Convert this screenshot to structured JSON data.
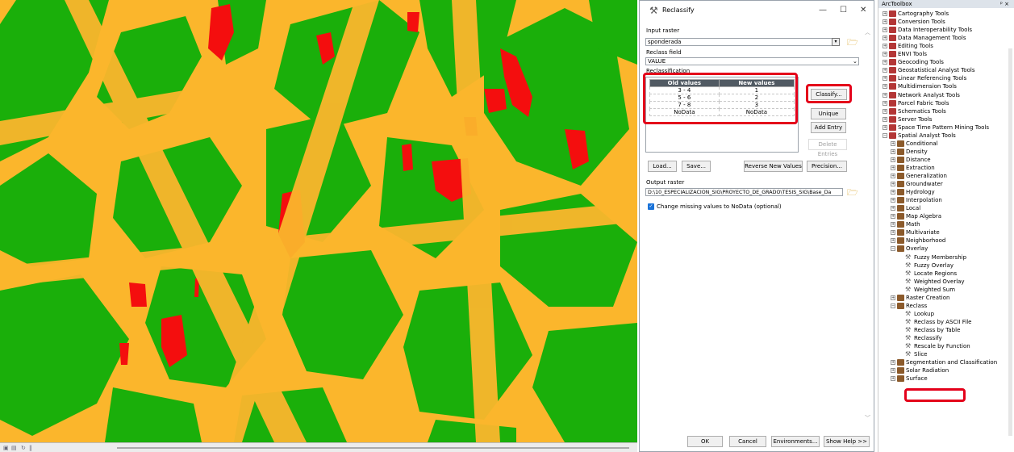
{
  "dialog": {
    "title": "Reclassify",
    "input_raster_label": "Input raster",
    "input_raster_value": "sponderada",
    "reclass_field_label": "Reclass field",
    "reclass_field_value": "VALUE",
    "reclassification_label": "Reclassification",
    "table": {
      "headers": [
        "Old values",
        "New values"
      ],
      "rows": [
        [
          "3 - 4",
          "1"
        ],
        [
          "5 - 6",
          "2"
        ],
        [
          "7 - 8",
          "3"
        ],
        [
          "NoData",
          "NoData"
        ]
      ]
    },
    "buttons": {
      "classify": "Classify...",
      "unique": "Unique",
      "add_entry": "Add Entry",
      "delete_entries": "Delete Entries",
      "load": "Load...",
      "save": "Save...",
      "reverse": "Reverse New Values",
      "precision": "Precision...",
      "ok": "OK",
      "cancel": "Cancel",
      "environments": "Environments...",
      "show_help": "Show Help >>"
    },
    "output_raster_label": "Output raster",
    "output_raster_value": "D:\\10_ESPECIALIZACION_SIG\\PROYECTO_DE_GRADO\\TESIS_SIG\\Base_Da",
    "change_missing_label": "Change missing values to NoData (optional)",
    "change_missing_checked": true
  },
  "toolbox": {
    "title": "ArcToolbox",
    "toolsets": [
      "Cartography Tools",
      "Conversion Tools",
      "Data Interoperability Tools",
      "Data Management Tools",
      "Editing Tools",
      "ENVI Tools",
      "Geocoding Tools",
      "Geostatistical Analyst Tools",
      "Linear Referencing Tools",
      "Multidimension Tools",
      "Network Analyst Tools",
      "Parcel Fabric Tools",
      "Schematics Tools",
      "Server Tools",
      "Space Time Pattern Mining Tools",
      "Spatial Analyst Tools"
    ],
    "spatial_children": [
      "Conditional",
      "Density",
      "Distance",
      "Extraction",
      "Generalization",
      "Groundwater",
      "Hydrology",
      "Interpolation",
      "Local",
      "Map Algebra",
      "Math",
      "Multivariate",
      "Neighborhood",
      "Overlay"
    ],
    "overlay_tools": [
      "Fuzzy Membership",
      "Fuzzy Overlay",
      "Locate Regions",
      "Weighted Overlay",
      "Weighted Sum"
    ],
    "after_overlay": [
      "Raster Creation",
      "Reclass"
    ],
    "reclass_tools": [
      "Lookup",
      "Reclass by ASCII File",
      "Reclass by Table",
      "Reclassify",
      "Rescale by Function",
      "Slice"
    ],
    "tail": [
      "Segmentation and Classification",
      "Solar Radiation",
      "Surface"
    ]
  },
  "colors": {
    "map_orange": "#fbb62c",
    "map_green": "#1aaf0a",
    "map_red": "#f40e0e",
    "highlight": "#e4001a"
  }
}
